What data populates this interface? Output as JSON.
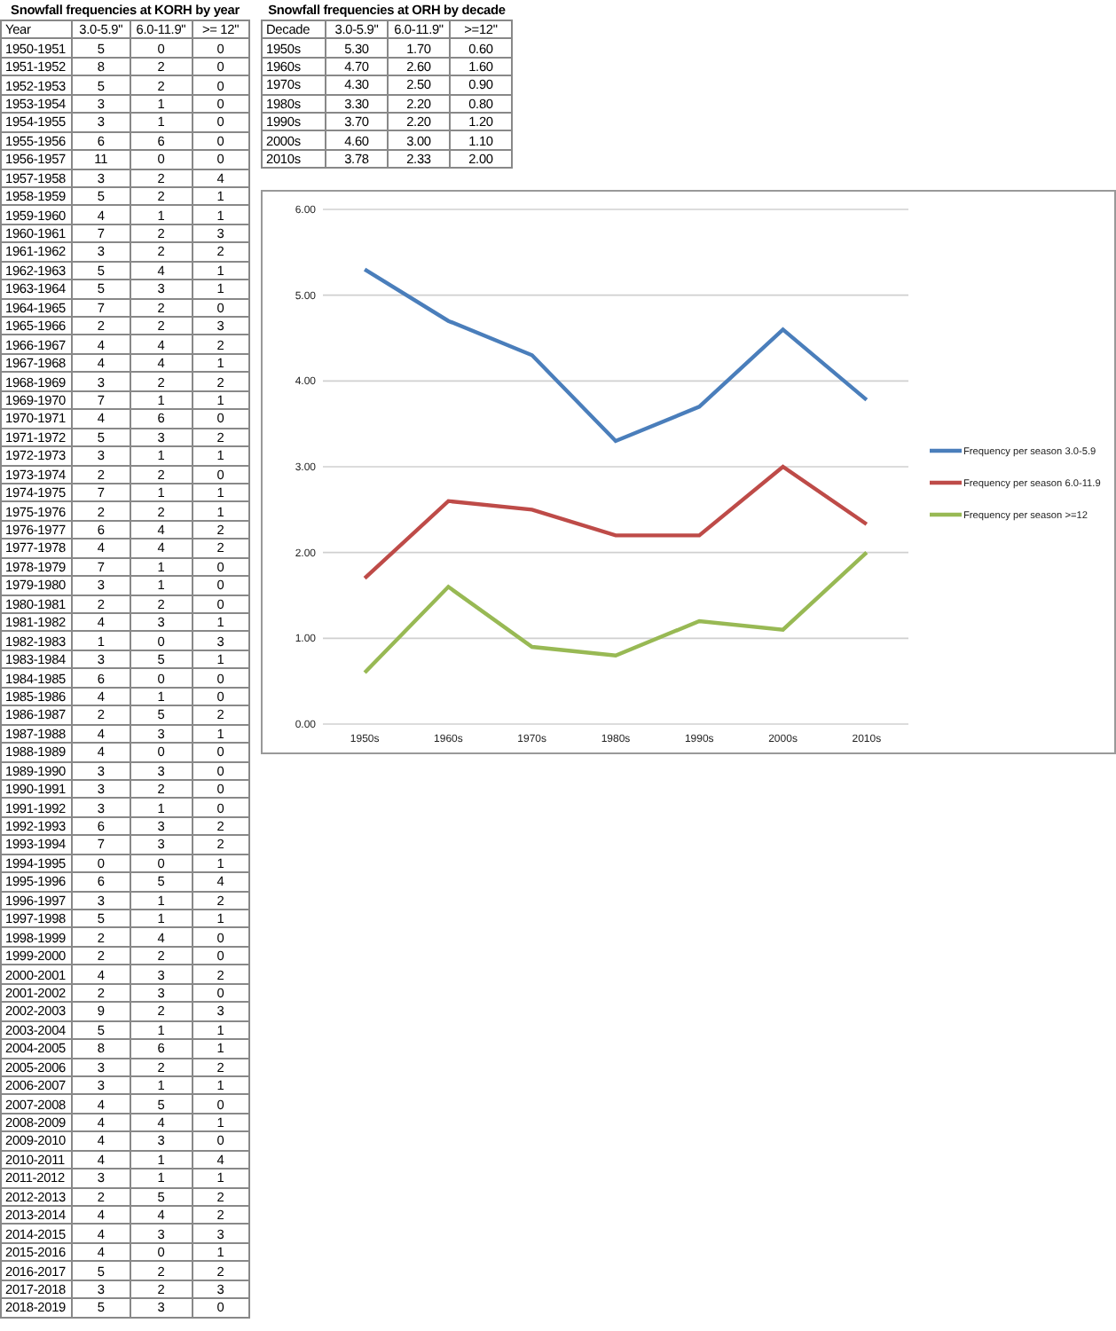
{
  "year_table": {
    "title": "Snowfall frequencies at KORH by year",
    "columns": [
      "Year",
      "3.0-5.9\"",
      "6.0-11.9\"",
      ">= 12\""
    ],
    "rows": [
      [
        "1950-1951",
        "5",
        "0",
        "0"
      ],
      [
        "1951-1952",
        "8",
        "2",
        "0"
      ],
      [
        "1952-1953",
        "5",
        "2",
        "0"
      ],
      [
        "1953-1954",
        "3",
        "1",
        "0"
      ],
      [
        "1954-1955",
        "3",
        "1",
        "0"
      ],
      [
        "1955-1956",
        "6",
        "6",
        "0"
      ],
      [
        "1956-1957",
        "11",
        "0",
        "0"
      ],
      [
        "1957-1958",
        "3",
        "2",
        "4"
      ],
      [
        "1958-1959",
        "5",
        "2",
        "1"
      ],
      [
        "1959-1960",
        "4",
        "1",
        "1"
      ],
      [
        "1960-1961",
        "7",
        "2",
        "3"
      ],
      [
        "1961-1962",
        "3",
        "2",
        "2"
      ],
      [
        "1962-1963",
        "5",
        "4",
        "1"
      ],
      [
        "1963-1964",
        "5",
        "3",
        "1"
      ],
      [
        "1964-1965",
        "7",
        "2",
        "0"
      ],
      [
        "1965-1966",
        "2",
        "2",
        "3"
      ],
      [
        "1966-1967",
        "4",
        "4",
        "2"
      ],
      [
        "1967-1968",
        "4",
        "4",
        "1"
      ],
      [
        "1968-1969",
        "3",
        "2",
        "2"
      ],
      [
        "1969-1970",
        "7",
        "1",
        "1"
      ],
      [
        "1970-1971",
        "4",
        "6",
        "0"
      ],
      [
        "1971-1972",
        "5",
        "3",
        "2"
      ],
      [
        "1972-1973",
        "3",
        "1",
        "1"
      ],
      [
        "1973-1974",
        "2",
        "2",
        "0"
      ],
      [
        "1974-1975",
        "7",
        "1",
        "1"
      ],
      [
        "1975-1976",
        "2",
        "2",
        "1"
      ],
      [
        "1976-1977",
        "6",
        "4",
        "2"
      ],
      [
        "1977-1978",
        "4",
        "4",
        "2"
      ],
      [
        "1978-1979",
        "7",
        "1",
        "0"
      ],
      [
        "1979-1980",
        "3",
        "1",
        "0"
      ],
      [
        "1980-1981",
        "2",
        "2",
        "0"
      ],
      [
        "1981-1982",
        "4",
        "3",
        "1"
      ],
      [
        "1982-1983",
        "1",
        "0",
        "3"
      ],
      [
        "1983-1984",
        "3",
        "5",
        "1"
      ],
      [
        "1984-1985",
        "6",
        "0",
        "0"
      ],
      [
        "1985-1986",
        "4",
        "1",
        "0"
      ],
      [
        "1986-1987",
        "2",
        "5",
        "2"
      ],
      [
        "1987-1988",
        "4",
        "3",
        "1"
      ],
      [
        "1988-1989",
        "4",
        "0",
        "0"
      ],
      [
        "1989-1990",
        "3",
        "3",
        "0"
      ],
      [
        "1990-1991",
        "3",
        "2",
        "0"
      ],
      [
        "1991-1992",
        "3",
        "1",
        "0"
      ],
      [
        "1992-1993",
        "6",
        "3",
        "2"
      ],
      [
        "1993-1994",
        "7",
        "3",
        "2"
      ],
      [
        "1994-1995",
        "0",
        "0",
        "1"
      ],
      [
        "1995-1996",
        "6",
        "5",
        "4"
      ],
      [
        "1996-1997",
        "3",
        "1",
        "2"
      ],
      [
        "1997-1998",
        "5",
        "1",
        "1"
      ],
      [
        "1998-1999",
        "2",
        "4",
        "0"
      ],
      [
        "1999-2000",
        "2",
        "2",
        "0"
      ],
      [
        "2000-2001",
        "4",
        "3",
        "2"
      ],
      [
        "2001-2002",
        "2",
        "3",
        "0"
      ],
      [
        "2002-2003",
        "9",
        "2",
        "3"
      ],
      [
        "2003-2004",
        "5",
        "1",
        "1"
      ],
      [
        "2004-2005",
        "8",
        "6",
        "1"
      ],
      [
        "2005-2006",
        "3",
        "2",
        "2"
      ],
      [
        "2006-2007",
        "3",
        "1",
        "1"
      ],
      [
        "2007-2008",
        "4",
        "5",
        "0"
      ],
      [
        "2008-2009",
        "4",
        "4",
        "1"
      ],
      [
        "2009-2010",
        "4",
        "3",
        "0"
      ],
      [
        "2010-2011",
        "4",
        "1",
        "4"
      ],
      [
        "2011-2012",
        "3",
        "1",
        "1"
      ],
      [
        "2012-2013",
        "2",
        "5",
        "2"
      ],
      [
        "2013-2014",
        "4",
        "4",
        "2"
      ],
      [
        "2014-2015",
        "4",
        "3",
        "3"
      ],
      [
        "2015-2016",
        "4",
        "0",
        "1"
      ],
      [
        "2016-2017",
        "5",
        "2",
        "2"
      ],
      [
        "2017-2018",
        "3",
        "2",
        "3"
      ],
      [
        "2018-2019",
        "5",
        "3",
        "0"
      ]
    ]
  },
  "decade_table": {
    "title": "Snowfall frequencies at ORH by decade",
    "columns": [
      "Decade",
      "3.0-5.9\"",
      "6.0-11.9\"",
      ">=12\""
    ],
    "rows": [
      [
        "1950s",
        "5.30",
        "1.70",
        "0.60"
      ],
      [
        "1960s",
        "4.70",
        "2.60",
        "1.60"
      ],
      [
        "1970s",
        "4.30",
        "2.50",
        "0.90"
      ],
      [
        "1980s",
        "3.30",
        "2.20",
        "0.80"
      ],
      [
        "1990s",
        "3.70",
        "2.20",
        "1.20"
      ],
      [
        "2000s",
        "4.60",
        "3.00",
        "1.10"
      ],
      [
        "2010s",
        "3.78",
        "2.33",
        "2.00"
      ]
    ]
  },
  "chart": {
    "chart_data": {
      "type": "line",
      "grid": true,
      "legend": true,
      "categories": [
        "1950s",
        "1960s",
        "1970s",
        "1980s",
        "1990s",
        "2000s",
        "2010s"
      ],
      "ylim": [
        0,
        6
      ],
      "yticks": [
        {
          "value": 0,
          "label": "0.00"
        },
        {
          "value": 1,
          "label": "1.00"
        },
        {
          "value": 2,
          "label": "2.00"
        },
        {
          "value": 3,
          "label": "3.00"
        },
        {
          "value": 4,
          "label": "4.00"
        },
        {
          "value": 5,
          "label": "5.00"
        },
        {
          "value": 6,
          "label": "6.00"
        }
      ],
      "series": [
        {
          "name": "Frequency per season 3.0-5.9",
          "color": "#4a7ebb",
          "values": [
            5.3,
            4.7,
            4.3,
            3.3,
            3.7,
            4.6,
            3.78
          ]
        },
        {
          "name": "Frequency per season 6.0-11.9",
          "color": "#be4b48",
          "values": [
            1.7,
            2.6,
            2.5,
            2.2,
            2.2,
            3.0,
            2.33
          ]
        },
        {
          "name": "Frequency per season >=12",
          "color": "#98b954",
          "values": [
            0.6,
            1.6,
            0.9,
            0.8,
            1.2,
            1.1,
            2.0
          ]
        }
      ]
    }
  }
}
